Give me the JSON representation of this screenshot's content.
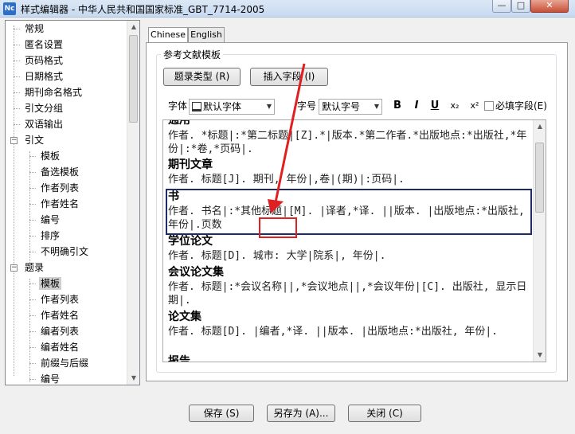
{
  "window": {
    "icon_text": "Nc",
    "title": "样式编辑器 - 中华人民共和国国家标准_GBT_7714-2005",
    "minimize_glyph": "—",
    "maximize_glyph": "□",
    "close_glyph": "✕"
  },
  "tree": {
    "items": [
      {
        "label": "常规"
      },
      {
        "label": "匿名设置"
      },
      {
        "label": "页码格式"
      },
      {
        "label": "日期格式"
      },
      {
        "label": "期刊命名格式"
      },
      {
        "label": "引文分组"
      },
      {
        "label": "双语输出"
      },
      {
        "label": "引文"
      },
      {
        "label": "模板"
      },
      {
        "label": "备选模板"
      },
      {
        "label": "作者列表"
      },
      {
        "label": "作者姓名"
      },
      {
        "label": "编号"
      },
      {
        "label": "排序"
      },
      {
        "label": "不明确引文"
      },
      {
        "label": "题录"
      },
      {
        "label": "模板"
      },
      {
        "label": "作者列表"
      },
      {
        "label": "作者姓名"
      },
      {
        "label": "编者列表"
      },
      {
        "label": "编者姓名"
      },
      {
        "label": "前缀与后缀"
      },
      {
        "label": "编号"
      }
    ]
  },
  "tabs": [
    {
      "label": "Chinese"
    },
    {
      "label": "English"
    }
  ],
  "group": {
    "title": "参考文献模板",
    "ref_type_button": "题录类型 (R)",
    "insert_field_button": "插入字段 (I)",
    "font_label": "字体",
    "font_value": "默认字体",
    "size_label": "字号",
    "size_value": "默认字号",
    "bold": "B",
    "italic": "I",
    "underline": "U",
    "subscript": "x₂",
    "superscript": "x²",
    "required_field_label": "必填字段(E)"
  },
  "templates": [
    {
      "title": "通用",
      "body": "作者. *标题|:*第二标题|[Z].*|版本.*第二作者.*出版地点:*出版社,*年份|:*卷,*页码|."
    },
    {
      "title": "期刊文章",
      "body": "作者. 标题[J]. 期刊, 年份|,卷|(期)|:页码|."
    },
    {
      "title": "书",
      "body_part1": "作者. 书名|:*其他标题|[M]. |译者,*译. ||版本. |出版地点:*出版社, 年份|.",
      "body_part2": "页数"
    },
    {
      "title": "学位论文",
      "body": "作者. 标题[D]. 城市: 大学|院系|, 年份|."
    },
    {
      "title": "会议论文集",
      "body": "作者. 标题|:*会议名称||,*会议地点||,*会议年份|[C]. 出版社, 显示日期|."
    },
    {
      "title": "论文集",
      "body": "作者. 标题[D]. |编者,*译. ||版本. |出版地点:*出版社, 年份|."
    },
    {
      "title": "报告",
      "body": ""
    }
  ],
  "buttons": {
    "save": "保存 (S)",
    "save_as": "另存为 (A)...",
    "close": "关闭 (C)"
  },
  "colors": {
    "highlight_border": "#1f2a6b",
    "annotation_red": "#e02020"
  }
}
